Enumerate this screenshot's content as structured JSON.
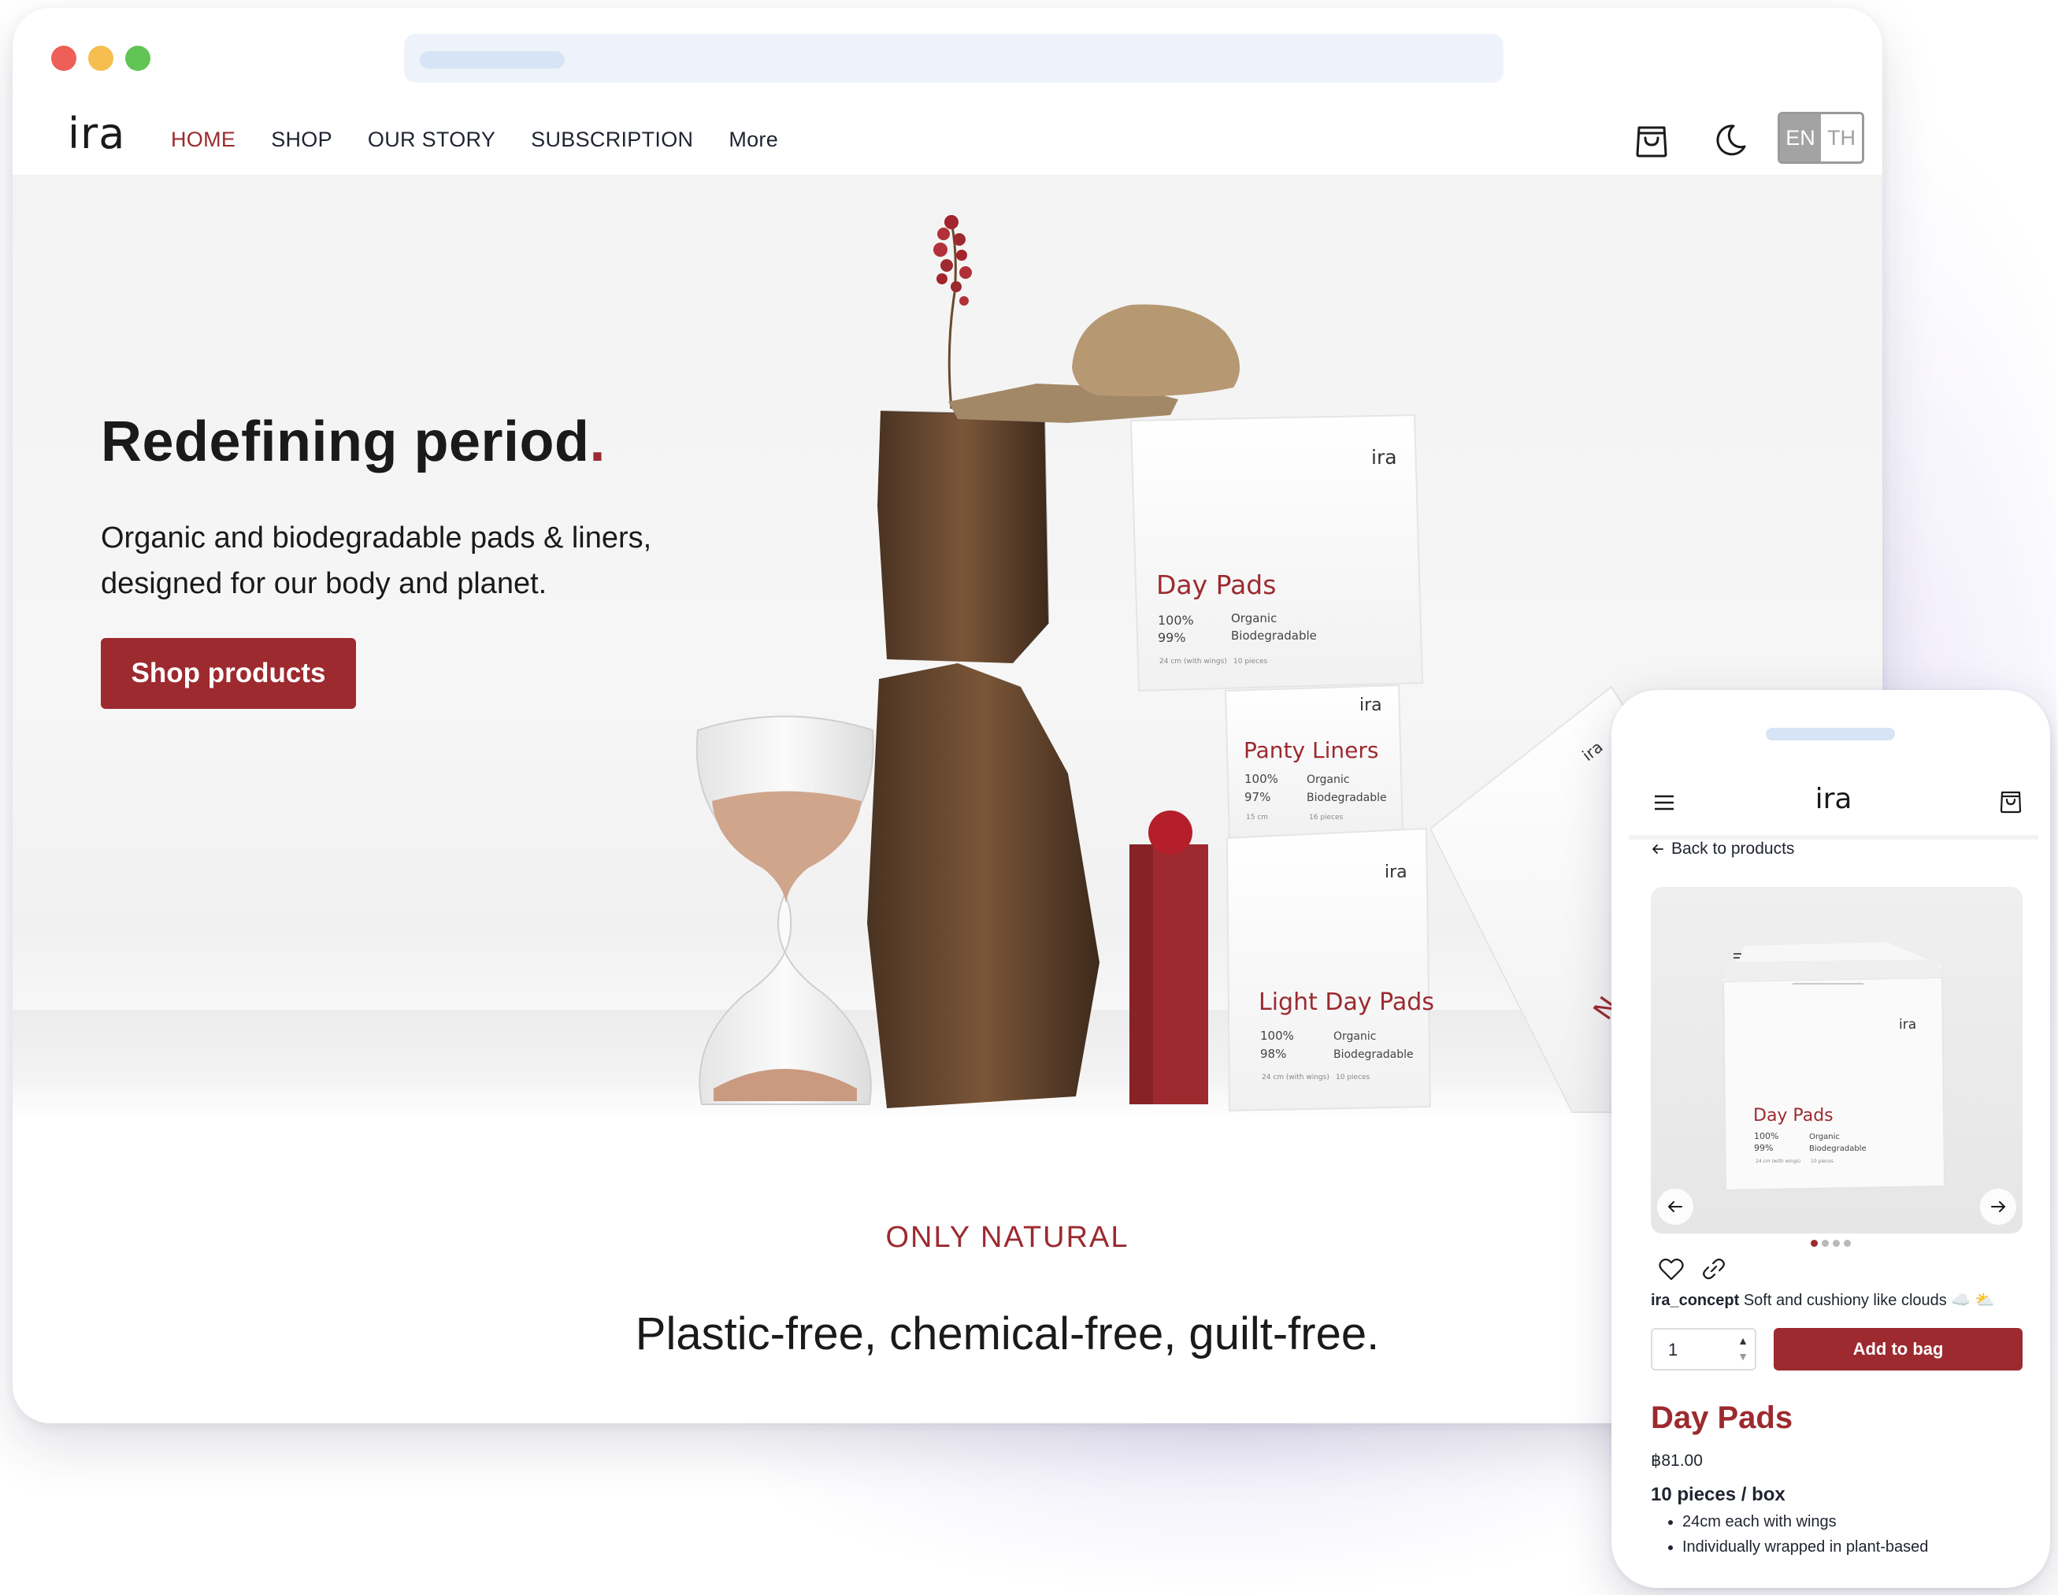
{
  "brand": {
    "logo": "ira",
    "accent_color": "#9c2a2f"
  },
  "nav": {
    "items": [
      {
        "label": "HOME",
        "active": true
      },
      {
        "label": "SHOP",
        "active": false
      },
      {
        "label": "OUR STORY",
        "active": false
      },
      {
        "label": "SUBSCRIPTION",
        "active": false
      },
      {
        "label": "More",
        "active": false
      }
    ],
    "icons": [
      "shopping-bag-icon",
      "moon-icon"
    ],
    "language": {
      "options": [
        "EN",
        "TH"
      ],
      "selected": "EN"
    }
  },
  "hero": {
    "title": "Redefining period",
    "title_accent": ".",
    "subtitle_line1": "Organic and biodegradable pads & liners,",
    "subtitle_line2": "designed for our body and planet.",
    "cta": "Shop products",
    "boxes": [
      {
        "brand": "ira",
        "name": "Day Pads",
        "pct1": "100%",
        "pct2": "99%",
        "label1": "Organic",
        "label2": "Biodegradable",
        "size": "24 cm (with wings)",
        "count": "10 pieces"
      },
      {
        "brand": "ira",
        "name": "Panty Liners",
        "pct1": "100%",
        "pct2": "97%",
        "label1": "Organic",
        "label2": "Biodegradable",
        "size": "15 cm",
        "count": "16 pieces"
      },
      {
        "brand": "ira",
        "name": "Light Day Pads",
        "pct1": "100%",
        "pct2": "98%",
        "label1": "Organic",
        "label2": "Biodegradable",
        "size": "24 cm (with wings)",
        "count": "10 pieces"
      },
      {
        "brand": "ira",
        "name": "N"
      }
    ]
  },
  "section": {
    "kicker": "ONLY NATURAL",
    "heading": "Plastic-free, chemical-free, guilt-free."
  },
  "mobile": {
    "logo": "ira",
    "back_link": "Back to products",
    "product_image_box": {
      "brand": "ira",
      "name": "Day Pads",
      "pct1": "100%",
      "pct2": "99%",
      "label1": "Organic",
      "label2": "Biodegradable",
      "size": "24 cm (with wings)",
      "count": "10 pieces"
    },
    "carousel": {
      "count": 4,
      "active_index": 0
    },
    "caption_user": "ira_concept",
    "caption_text": "Soft and cushiony like clouds ☁️ ⛅",
    "quantity": "1",
    "add_button": "Add to bag",
    "product": {
      "name": "Day Pads",
      "price": "฿81.00",
      "pack": "10 pieces / box",
      "bullets": [
        "24cm each with wings",
        "Individually wrapped in plant-based"
      ]
    }
  }
}
